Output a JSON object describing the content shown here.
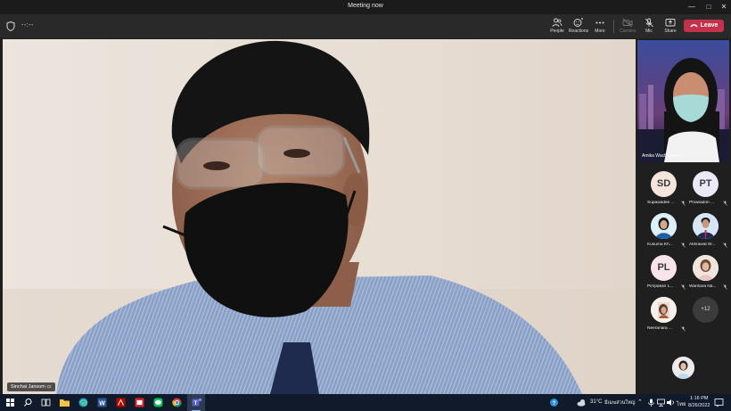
{
  "window": {
    "title": "Meeting now"
  },
  "meeting": {
    "timer": "--:--"
  },
  "toolbar": {
    "people": "People",
    "reactions": "Reactions",
    "more": "More",
    "camera": "Camera",
    "mic": "Mic",
    "share": "Share",
    "leave": "Leave"
  },
  "stage": {
    "speaker_name": "Sinchai Jansom"
  },
  "featured": {
    "name": "Amika Wachirawin"
  },
  "participants": [
    {
      "initials": "SD",
      "name": "Supawadee ..."
    },
    {
      "initials": "PT",
      "name": "Phuwadon ..."
    },
    {
      "initials": "",
      "name": "Kusuma Kh..."
    },
    {
      "initials": "",
      "name": "Akkrawat W..."
    },
    {
      "initials": "PL",
      "name": "Pimpakan L..."
    },
    {
      "initials": "",
      "name": "Warisara Na..."
    },
    {
      "initials": "",
      "name": "Neeranara ..."
    },
    {
      "initials": "+12",
      "name": ""
    }
  ],
  "taskbar": {
    "weather_temp": "31°C",
    "weather_desc": "มีเมฆส่วนใหญ่",
    "language": "ไทย",
    "time": "1:16 PM",
    "date": "8/26/2022"
  },
  "colors": {
    "leave": "#c4314b",
    "toolbar": "#292929",
    "panel": "#1f1f1f"
  }
}
